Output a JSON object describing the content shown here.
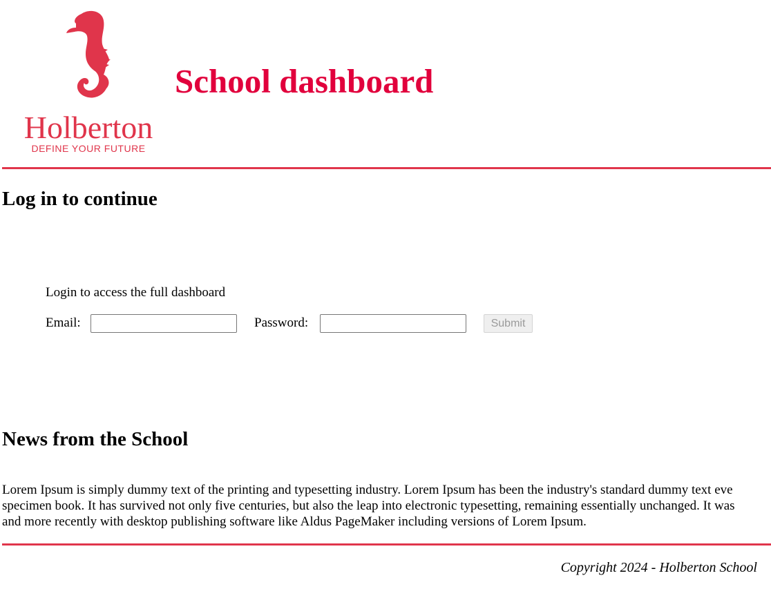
{
  "header": {
    "logo": {
      "icon": "seahorse-icon",
      "wordmark": "Holberton",
      "tagline": "DEFINE YOUR FUTURE",
      "color": "#e0354b"
    },
    "title": "School dashboard",
    "title_color": "#e1003c"
  },
  "login": {
    "heading": "Log in to continue",
    "description": "Login to access the full dashboard",
    "email_label": "Email:",
    "email_value": "",
    "password_label": "Password:",
    "password_value": "",
    "submit_label": "Submit",
    "submit_disabled": true
  },
  "news": {
    "heading": "News from the School",
    "lines": [
      "Lorem Ipsum is simply dummy text of the printing and typesetting industry. Lorem Ipsum has been the industry's standard dummy text eve",
      "specimen book. It has survived not only five centuries, but also the leap into electronic typesetting, remaining essentially unchanged. It was",
      "and more recently with desktop publishing software like Aldus PageMaker including versions of Lorem Ipsum."
    ]
  },
  "footer": {
    "copyright": "Copyright 2024 - Holberton School"
  },
  "colors": {
    "accent": "#e0354b",
    "rule": "#e0354b"
  }
}
